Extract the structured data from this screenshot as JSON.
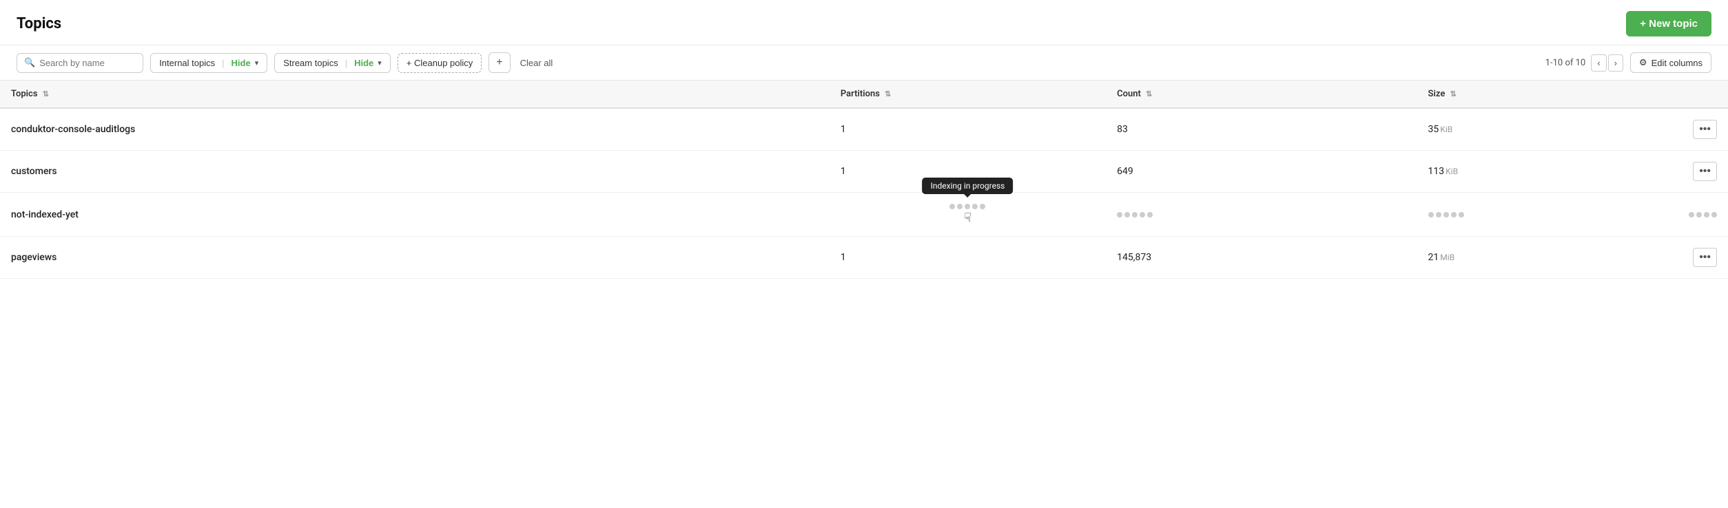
{
  "header": {
    "title": "Topics",
    "new_topic_label": "+ New topic"
  },
  "toolbar": {
    "search_placeholder": "Search by name",
    "internal_topics_label": "Internal topics",
    "internal_topics_hide": "Hide",
    "stream_topics_label": "Stream topics",
    "stream_topics_hide": "Hide",
    "cleanup_policy_label": "+ Cleanup policy",
    "add_icon": "+",
    "clear_all_label": "Clear all",
    "pagination_text": "1-10 of 10",
    "edit_columns_label": "Edit columns"
  },
  "table": {
    "columns": [
      {
        "id": "topics",
        "label": "Topics"
      },
      {
        "id": "partitions",
        "label": "Partitions"
      },
      {
        "id": "count",
        "label": "Count"
      },
      {
        "id": "size",
        "label": "Size"
      }
    ],
    "rows": [
      {
        "name": "conduktor-console-auditlogs",
        "partitions": "1",
        "count": "83",
        "size": "35",
        "size_unit": "KiB",
        "indexing": false
      },
      {
        "name": "customers",
        "partitions": "1",
        "count": "649",
        "size": "113",
        "size_unit": "KiB",
        "indexing": false
      },
      {
        "name": "not-indexed-yet",
        "partitions": null,
        "count": null,
        "size": null,
        "size_unit": null,
        "indexing": true
      },
      {
        "name": "pageviews",
        "partitions": "1",
        "count": "145,873",
        "size": "21",
        "size_unit": "MiB",
        "indexing": false
      }
    ],
    "tooltip_text": "Indexing in progress"
  },
  "icons": {
    "search": "🔍",
    "sort": "⇅",
    "gear": "⚙",
    "chevron_down": "▾",
    "prev": "‹",
    "next": "›",
    "cursor": "☞",
    "dots": "•••"
  }
}
